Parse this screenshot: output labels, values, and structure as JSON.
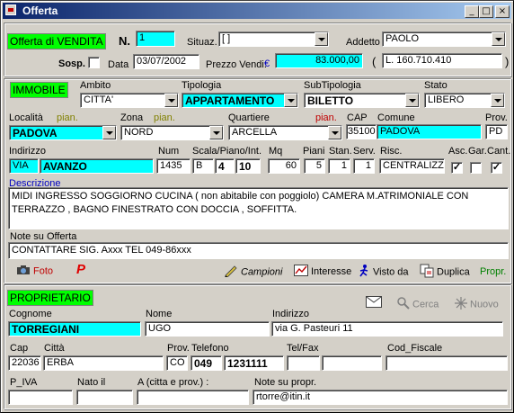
{
  "window": {
    "title": "Offerta",
    "min_glyph": "_",
    "max_glyph": "□",
    "close_glyph": "×"
  },
  "header": {
    "offer_type": "Offerta di VENDITA",
    "n_label": "N.",
    "n_value": "1",
    "situaz_label": "Situaz.",
    "situaz_value": "[ ]",
    "addetto_label": "Addetto",
    "addetto_value": "PAOLO",
    "sosp_label": "Sosp.",
    "data_label": "Data",
    "data_value": "03/07/2002",
    "prezzo_label": "Prezzo Vendi.",
    "euro_symbol": "€",
    "prezzo_value": "83.000,00",
    "paren_open": "(",
    "lire_value": "L. 160.710.410",
    "paren_close": ")"
  },
  "immobile": {
    "section_label": "IMMOBILE",
    "ambito_label": "Ambito",
    "ambito_value": "CITTA'",
    "tipologia_label": "Tipologia",
    "tipologia_value": "APPARTAMENTO",
    "subtipologia_label": "SubTipologia",
    "subtipologia_value": "BILETTO",
    "stato_label": "Stato",
    "stato_value": "LIBERO",
    "localita_label": "Località",
    "localita_pian": "pian.",
    "localita_value": "PADOVA",
    "zona_label": "Zona",
    "zona_pian": "pian.",
    "zona_value": "NORD",
    "quartiere_label": "Quartiere",
    "quartiere_pian": "pian.",
    "quartiere_value": "ARCELLA",
    "cap_label": "CAP",
    "cap_value": "35100",
    "comune_label": "Comune",
    "comune_value": "PADOVA",
    "prov_label": "Prov.",
    "prov_value": "PD",
    "indirizzo_label": "Indirizzo",
    "via_value": "VIA",
    "indirizzo_value": "AVANZO",
    "num_label": "Num",
    "num_value": "1435",
    "scala_label": "Scala/Piano/Int.",
    "scala_value": "B",
    "piano_value": "4",
    "int_value": "10",
    "mq_label": "Mq",
    "mq_value": "60",
    "piani_label": "Piani",
    "piani_value": "5",
    "stan_label": "Stan.",
    "stan_value": "1",
    "serv_label": "Serv.",
    "serv_value": "1",
    "risc_label": "Risc.",
    "risc_value": "CENTRALIZZ",
    "asc_label": "Asc.",
    "asc_checked": "✓",
    "gar_label": "Gar.",
    "gar_checked": "",
    "cant_label": "Cant.",
    "cant_checked": "✓",
    "descrizione_label": "Descrizione",
    "descrizione_line1": "MIDI INGRESSO SOGGIORNO CUCINA ( non abitabile con poggiolo) CAMERA M.ATRIMONIALE CON",
    "descrizione_line2": "TERRAZZO , BAGNO FINESTRATO CON DOCCIA , SOFFITTA.",
    "note_label": "Note su Offerta",
    "note_value": "CONTATTARE SIG. Axxx TEL 049-86xxx"
  },
  "toolbar": {
    "foto": "Foto",
    "p_label": "P",
    "campioni": "Campioni",
    "interesse": "Interesse",
    "visto_da": "Visto da",
    "duplica": "Duplica",
    "propr": "Propr."
  },
  "proprietario": {
    "section_label": "PROPRIETARIO",
    "cerca": "Cerca",
    "nuovo": "Nuovo",
    "cognome_label": "Cognome",
    "cognome_value": "TORREGIANI",
    "nome_label": "Nome",
    "nome_value": "UGO",
    "indirizzo_label": "Indirizzo",
    "indirizzo_value": "via G. Pasteuri 11",
    "cap_label": "Cap",
    "cap_value": "22036",
    "citta_label": "Città",
    "citta_value": "ERBA",
    "prov_label": "Prov.",
    "prov_value": "CO",
    "telefono_label": "Telefono",
    "tel_prefix": "049",
    "tel_number": "1231111",
    "telfax_label": "Tel/Fax",
    "telfax_value1": "",
    "telfax_value2": "",
    "codfiscale_label": "Cod_Fiscale",
    "codfiscale_value": "",
    "piva_label": "P_IVA",
    "piva_value": "",
    "natoil_label": "Nato il",
    "natoil_value": "",
    "a_label": "A (citta e prov.) :",
    "a_value": "",
    "notepropr_label": "Note su propr.",
    "notepropr_value": "rtorre@itin.it"
  },
  "colors": {
    "cyan": "#00ffff",
    "green": "#00ff00",
    "title_start": "#0a246a",
    "title_end": "#a6caf0"
  }
}
